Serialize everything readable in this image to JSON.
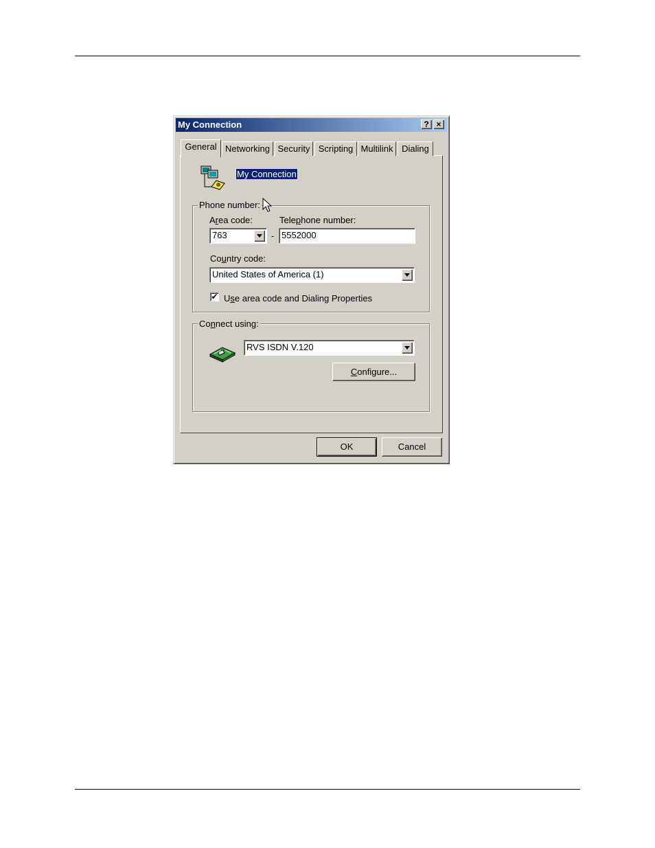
{
  "dialog": {
    "title": "My Connection",
    "help_button": "?",
    "close_button": "×",
    "tabs": [
      {
        "label": "General",
        "active": true
      },
      {
        "label": "Networking"
      },
      {
        "label": "Security"
      },
      {
        "label": "Scripting"
      },
      {
        "label": "Multilink"
      },
      {
        "label": "Dialing"
      }
    ],
    "connection_name": "My Connection",
    "phone_group": {
      "legend": "Phone number:",
      "area_code_label_pre": "A",
      "area_code_label_u": "r",
      "area_code_label_post": "ea code:",
      "area_code_value": "763",
      "separator": "-",
      "telephone_label_pre": "Tele",
      "telephone_label_u": "p",
      "telephone_label_post": "hone number:",
      "telephone_value": "5552000",
      "country_label_pre": "Co",
      "country_label_u": "u",
      "country_label_post": "ntry code:",
      "country_value": "United States of America (1)",
      "checkbox_checked": true,
      "checkbox_label_pre": "U",
      "checkbox_label_u": "s",
      "checkbox_label_post": "e area code and Dialing Properties"
    },
    "connect_group": {
      "legend_pre": "Co",
      "legend_u": "n",
      "legend_post": "nect using:",
      "device_value": "RVS ISDN V.120",
      "configure_u": "C",
      "configure_rest": "onfigure..."
    },
    "ok_label": "OK",
    "cancel_label": "Cancel"
  }
}
